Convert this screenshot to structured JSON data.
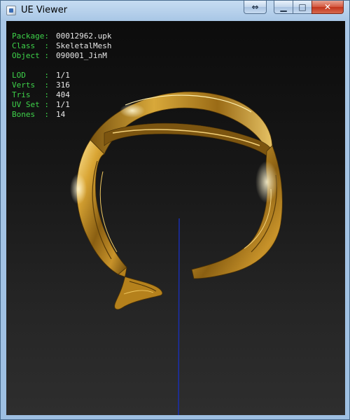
{
  "window": {
    "title": "UE Viewer",
    "buttons": {
      "swap": "⇔",
      "minimize": "▁",
      "maximize": "□",
      "close": "✕"
    }
  },
  "info_top": [
    {
      "label": "Package:",
      "value": "00012962.upk"
    },
    {
      "label": "Class  :",
      "value": "SkeletalMesh"
    },
    {
      "label": "Object :",
      "value": "090001_JinM"
    }
  ],
  "info_stats": [
    {
      "label": "LOD    :",
      "value": "1/1"
    },
    {
      "label": "Verts  :",
      "value": "316"
    },
    {
      "label": "Tris   :",
      "value": "404"
    },
    {
      "label": "UV Set :",
      "value": "1/1"
    },
    {
      "label": "Bones  :",
      "value": "14"
    }
  ],
  "colors": {
    "label": "#3ed34a",
    "value": "#e8e8e8",
    "axis": "#1a2fb0",
    "gold_dark": "#5a3c08",
    "gold_mid": "#b8861c",
    "gold_light": "#ffe07a"
  },
  "scene": {
    "object": "gold-circlet-mesh",
    "axis": "z-axis-line"
  }
}
